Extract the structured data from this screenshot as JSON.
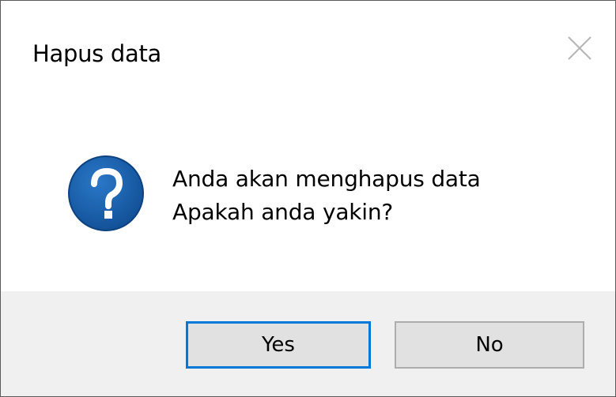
{
  "dialog": {
    "title": "Hapus data",
    "close_icon": "close-icon",
    "icon": "question-icon",
    "message_line1": "Anda akan menghapus data",
    "message_line2": "Apakah anda yakin?",
    "buttons": {
      "yes_label": "Yes",
      "no_label": "No"
    }
  },
  "colors": {
    "icon_fill": "#1a5fa8",
    "focus_border": "#0078d7",
    "footer_bg": "#f0f0f0",
    "button_bg": "#e1e1e1"
  }
}
